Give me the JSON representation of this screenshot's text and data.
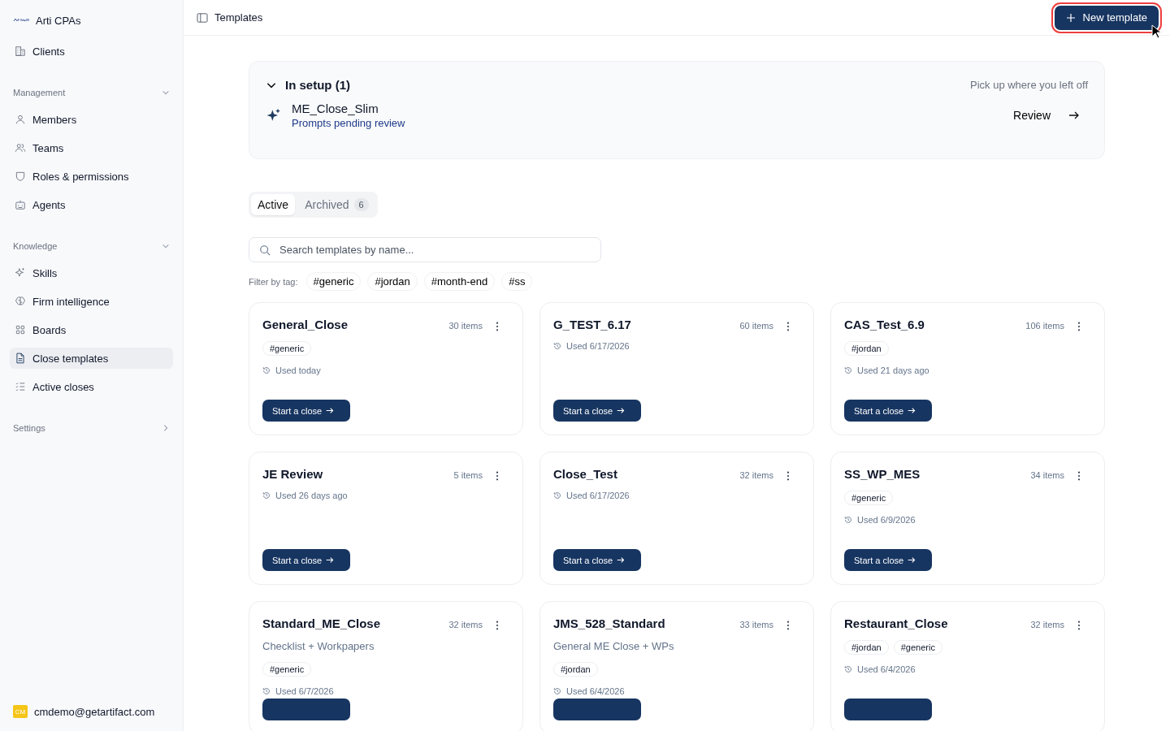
{
  "sidebar": {
    "org": "Arti CPAs",
    "top_items": [
      {
        "label": "Clients",
        "selected": false
      }
    ],
    "sections": [
      {
        "title": "Management",
        "expanded": true,
        "items": [
          {
            "label": "Members",
            "selected": false
          },
          {
            "label": "Teams",
            "selected": false
          },
          {
            "label": "Roles & permissions",
            "selected": false
          },
          {
            "label": "Agents",
            "selected": false
          }
        ]
      },
      {
        "title": "Knowledge",
        "expanded": true,
        "items": [
          {
            "label": "Skills",
            "selected": false
          },
          {
            "label": "Firm intelligence",
            "selected": false
          },
          {
            "label": "Boards",
            "selected": false
          },
          {
            "label": "Close templates",
            "selected": true
          },
          {
            "label": "Active closes",
            "selected": false
          }
        ]
      },
      {
        "title": "Settings",
        "expanded": false
      }
    ],
    "user": {
      "initials": "CM",
      "email": "cmdemo@getartifact.com"
    }
  },
  "header": {
    "title": "Templates",
    "new_button": "New template"
  },
  "setup": {
    "title": "In setup (1)",
    "expanded": true,
    "hint": "Pick up where you left off",
    "item_name": "ME_Close_Slim",
    "item_status": "Prompts pending review",
    "review_button": "Review"
  },
  "tabs": [
    {
      "label": "Active",
      "selected": true
    },
    {
      "label": "Archived",
      "selected": false,
      "count": "6"
    }
  ],
  "search": {
    "placeholder": "Search templates by name..."
  },
  "filter": {
    "label": "Filter by tag:",
    "tags": [
      "#generic",
      "#jordan",
      "#month-end",
      "#ss"
    ]
  },
  "templates": [
    {
      "name": "General_Close",
      "count": "30 items",
      "tags": [
        "#generic"
      ],
      "used": "Used today",
      "button": "Start a close"
    },
    {
      "name": "G_TEST_6.17",
      "count": "60 items",
      "used": "Used 6/17/2026",
      "button": "Start a close"
    },
    {
      "name": "CAS_Test_6.9",
      "count": "106 items",
      "tags": [
        "#jordan"
      ],
      "used": "Used 21 days ago",
      "button": "Start a close"
    },
    {
      "name": "JE Review",
      "count": "5 items",
      "used": "Used 26 days ago",
      "button": "Start a close"
    },
    {
      "name": "Close_Test",
      "count": "32 items",
      "used": "Used 6/17/2026",
      "button": "Start a close"
    },
    {
      "name": "SS_WP_MES",
      "count": "34 items",
      "tags": [
        "#generic"
      ],
      "used": "Used 6/9/2026",
      "button": "Start a close"
    },
    {
      "name": "Standard_ME_Close",
      "count": "32 items",
      "description": "Checklist + Workpapers",
      "tags": [
        "#generic"
      ],
      "used": "Used 6/7/2026"
    },
    {
      "name": "JMS_528_Standard",
      "count": "33 items",
      "description": "General ME Close + WPs",
      "tags": [
        "#jordan"
      ],
      "used": "Used 6/4/2026"
    },
    {
      "name": "Restaurant_Close",
      "count": "32 items",
      "tags": [
        "#jordan",
        "#generic"
      ],
      "used": "Used 6/4/2026"
    }
  ]
}
